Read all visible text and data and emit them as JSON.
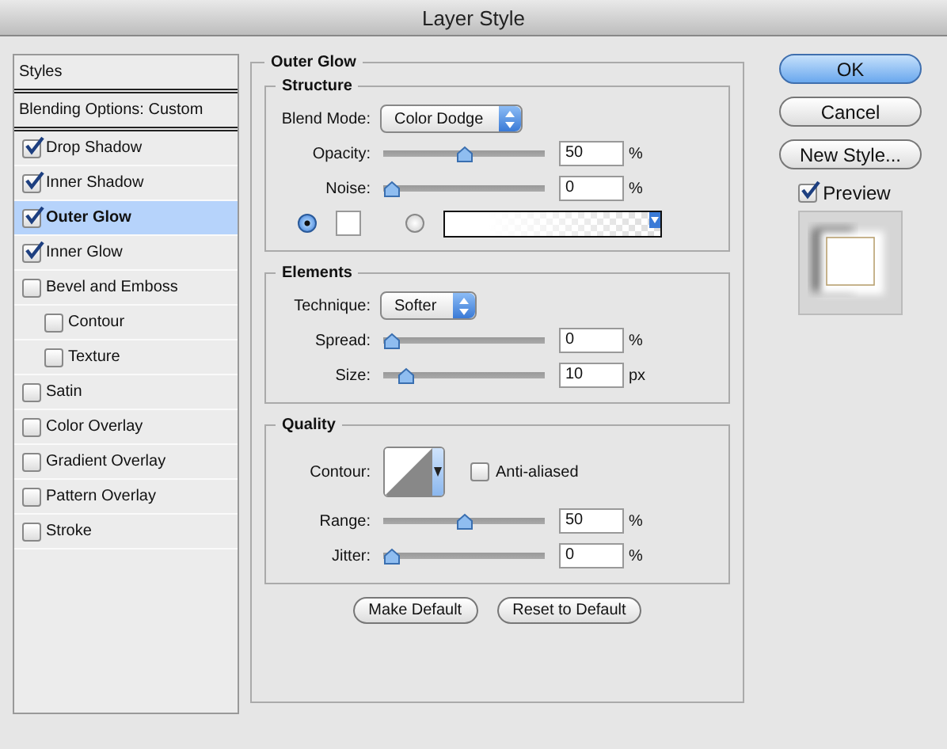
{
  "window": {
    "title": "Layer Style"
  },
  "styles_list": [
    {
      "label": "Styles",
      "kind": "header",
      "selected": false
    },
    {
      "label": "Blending Options: Custom",
      "kind": "header",
      "selected": false
    },
    {
      "label": "Drop Shadow",
      "kind": "check",
      "checked": true,
      "selected": false
    },
    {
      "label": "Inner Shadow",
      "kind": "check",
      "checked": true,
      "selected": false
    },
    {
      "label": "Outer Glow",
      "kind": "check",
      "checked": true,
      "selected": true
    },
    {
      "label": "Inner Glow",
      "kind": "check",
      "checked": true,
      "selected": false
    },
    {
      "label": "Bevel and Emboss",
      "kind": "check",
      "checked": false,
      "selected": false,
      "children": [
        {
          "label": "Contour",
          "kind": "check",
          "checked": false,
          "selected": false
        },
        {
          "label": "Texture",
          "kind": "check",
          "checked": false,
          "selected": false
        }
      ]
    },
    {
      "label": "Satin",
      "kind": "check",
      "checked": false,
      "selected": false
    },
    {
      "label": "Color Overlay",
      "kind": "check",
      "checked": false,
      "selected": false
    },
    {
      "label": "Gradient Overlay",
      "kind": "check",
      "checked": false,
      "selected": false
    },
    {
      "label": "Pattern Overlay",
      "kind": "check",
      "checked": false,
      "selected": false
    },
    {
      "label": "Stroke",
      "kind": "check",
      "checked": false,
      "selected": false
    }
  ],
  "panel": {
    "title": "Outer Glow",
    "groups": [
      {
        "title": "Structure",
        "rows": [
          {
            "kind": "select",
            "label": "Blend Mode:",
            "value": "Color Dodge"
          },
          {
            "kind": "slider",
            "label": "Opacity:",
            "level": 0.5,
            "value": "50",
            "unit": "%"
          },
          {
            "kind": "slider",
            "label": "Noise:",
            "level": 0,
            "value": "0",
            "unit": "%"
          },
          {
            "kind": "source",
            "options": [
              {
                "kind": "color",
                "selected": true
              },
              {
                "kind": "gradient",
                "selected": false
              }
            ]
          }
        ]
      },
      {
        "title": "Elements",
        "rows": [
          {
            "kind": "select",
            "label": "Technique:",
            "value": "Softer"
          },
          {
            "kind": "slider",
            "label": "Spread:",
            "level": 0,
            "value": "0",
            "unit": "%"
          },
          {
            "kind": "slider",
            "label": "Size:",
            "level": 0.1,
            "value": "10",
            "unit": "px"
          }
        ]
      },
      {
        "title": "Quality",
        "rows": [
          {
            "kind": "contour",
            "label": "Contour:",
            "checkbox": {
              "label": "Anti-aliased",
              "checked": false
            }
          },
          {
            "kind": "slider",
            "label": "Range:",
            "level": 0.5,
            "value": "50",
            "unit": "%"
          },
          {
            "kind": "slider",
            "label": "Jitter:",
            "level": 0,
            "value": "0",
            "unit": "%"
          }
        ]
      }
    ],
    "buttons": [
      "Make Default",
      "Reset to Default"
    ]
  },
  "actions": [
    {
      "label": "OK",
      "default": true
    },
    {
      "label": "Cancel",
      "default": false
    },
    {
      "label": "New Style...",
      "default": false
    }
  ],
  "preview": {
    "label": "Preview",
    "checked": true
  }
}
